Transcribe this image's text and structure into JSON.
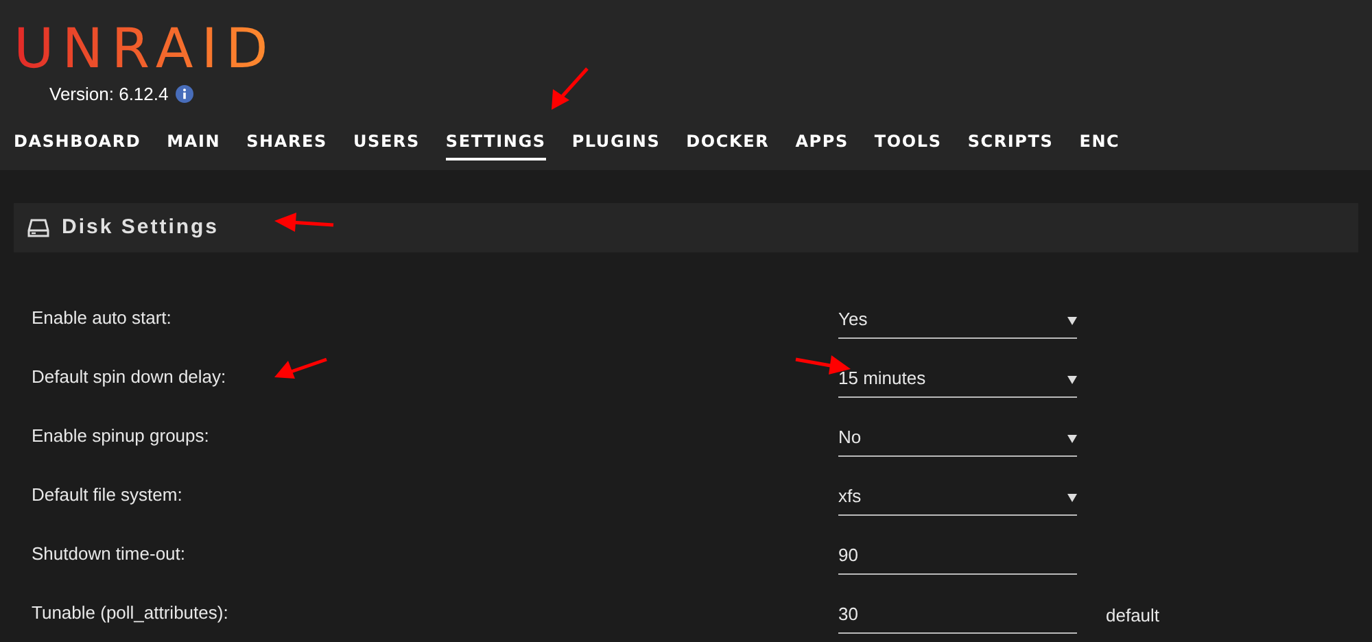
{
  "header": {
    "logo": "UNRAID",
    "version": "Version: 6.12.4"
  },
  "nav": [
    {
      "label": "DASHBOARD",
      "selected": false
    },
    {
      "label": "MAIN",
      "selected": false
    },
    {
      "label": "SHARES",
      "selected": false
    },
    {
      "label": "USERS",
      "selected": false
    },
    {
      "label": "SETTINGS",
      "selected": true
    },
    {
      "label": "PLUGINS",
      "selected": false
    },
    {
      "label": "DOCKER",
      "selected": false
    },
    {
      "label": "APPS",
      "selected": false
    },
    {
      "label": "TOOLS",
      "selected": false
    },
    {
      "label": "SCRIPTS",
      "selected": false
    },
    {
      "label": "ENC",
      "selected": false
    }
  ],
  "section": {
    "title": "Disk Settings"
  },
  "settings": [
    {
      "label": "Enable auto start:",
      "kind": "select",
      "value": "Yes"
    },
    {
      "label": "Default spin down delay:",
      "kind": "select",
      "value": "15 minutes"
    },
    {
      "label": "Enable spinup groups:",
      "kind": "select",
      "value": "No"
    },
    {
      "label": "Default file system:",
      "kind": "select",
      "value": "xfs"
    },
    {
      "label": "Shutdown time-out:",
      "kind": "text",
      "value": "90"
    },
    {
      "label": "Tunable (poll_attributes):",
      "kind": "text",
      "value": "30",
      "note": "default"
    }
  ]
}
